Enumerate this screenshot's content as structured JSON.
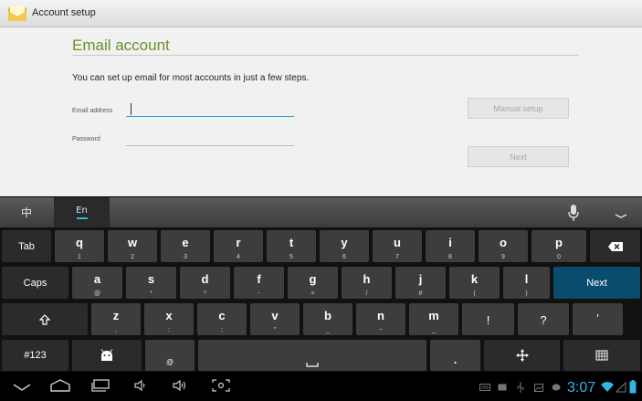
{
  "actionbar": {
    "title": "Account setup",
    "icon": "email-app-icon"
  },
  "form": {
    "heading": "Email account",
    "intro": "You can set up email for most accounts in just a few steps.",
    "email_label": "Email address",
    "email_value": "",
    "password_label": "Password",
    "password_value": "",
    "manual_setup": "Manual setup",
    "next": "Next"
  },
  "langbar": {
    "chinese": "中",
    "english": "En"
  },
  "keyboard": {
    "row1": [
      {
        "main": "Tab",
        "sub": ""
      },
      {
        "main": "q",
        "sub": "1"
      },
      {
        "main": "w",
        "sub": "2"
      },
      {
        "main": "e",
        "sub": "3"
      },
      {
        "main": "r",
        "sub": "4"
      },
      {
        "main": "t",
        "sub": "5"
      },
      {
        "main": "y",
        "sub": "6"
      },
      {
        "main": "u",
        "sub": "7"
      },
      {
        "main": "i",
        "sub": "8"
      },
      {
        "main": "o",
        "sub": "9"
      },
      {
        "main": "p",
        "sub": "0"
      }
    ],
    "row2": [
      {
        "main": "Caps",
        "sub": ""
      },
      {
        "main": "a",
        "sub": "@"
      },
      {
        "main": "s",
        "sub": "*"
      },
      {
        "main": "d",
        "sub": "*"
      },
      {
        "main": "f",
        "sub": "-"
      },
      {
        "main": "g",
        "sub": "="
      },
      {
        "main": "h",
        "sub": "/"
      },
      {
        "main": "j",
        "sub": "#"
      },
      {
        "main": "k",
        "sub": "("
      },
      {
        "main": "l",
        "sub": ")"
      },
      {
        "main": "Next",
        "sub": ""
      }
    ],
    "row3": [
      {
        "main": "z",
        "sub": ","
      },
      {
        "main": "x",
        "sub": ":"
      },
      {
        "main": "c",
        "sub": ";"
      },
      {
        "main": "v",
        "sub": "\""
      },
      {
        "main": "b",
        "sub": "_"
      },
      {
        "main": "n",
        "sub": "~"
      },
      {
        "main": "m",
        "sub": "_"
      },
      {
        "main": "!",
        "sub": ""
      },
      {
        "main": "?",
        "sub": ""
      },
      {
        "main": "'",
        "sub": ""
      }
    ],
    "row4": {
      "symbols": "#123",
      "at": "@",
      "period": "."
    }
  },
  "status": {
    "time": "3:07"
  }
}
